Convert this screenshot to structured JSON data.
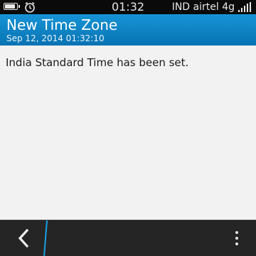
{
  "status_bar": {
    "time": "01:32",
    "carrier": "IND airtel 4g",
    "battery_level": 0.8,
    "icons": [
      "battery-icon",
      "alarm-icon",
      "signal-icon"
    ]
  },
  "header": {
    "title": "New Time Zone",
    "subtitle": "Sep 12, 2014 01:32:10"
  },
  "main": {
    "message": "India Standard Time has been set."
  },
  "action_bar": {
    "icons": [
      "back-icon",
      "overflow-menu-icon"
    ]
  },
  "colors": {
    "title_bar": "#0f86c8",
    "accent_blue": "#1aa0e6",
    "action_bar": "#252525",
    "background": "#f2f2f2"
  }
}
